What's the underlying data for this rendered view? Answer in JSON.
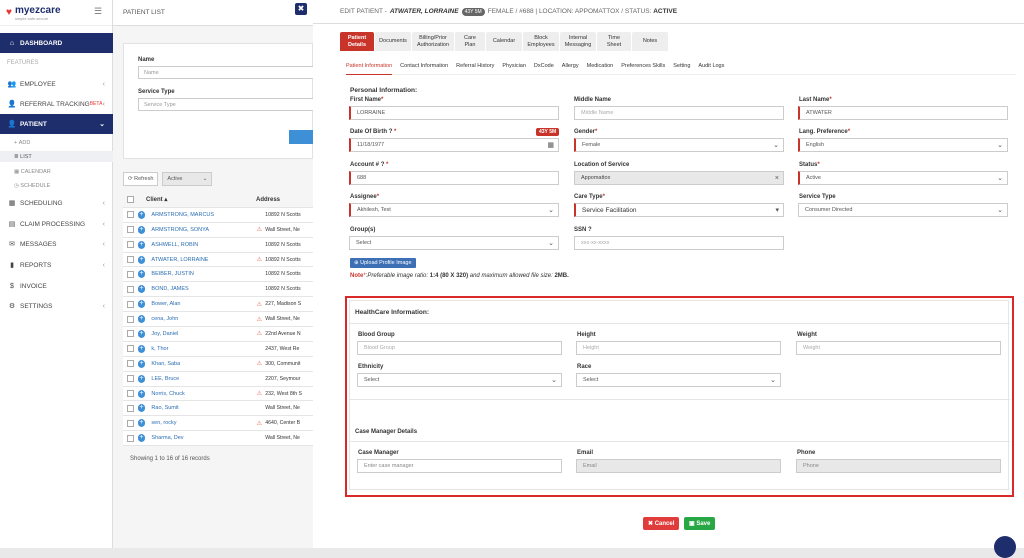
{
  "app": {
    "logo": "myezcare",
    "tagline": "simple.safe.secure"
  },
  "sidebar": {
    "dashboard": "DASHBOARD",
    "features": "FEATURES",
    "employee": "EMPLOYEE",
    "referral": "REFERRAL TRACKING",
    "beta": "beta",
    "patient": "PATIENT",
    "sub": [
      "ADD",
      "LIST",
      "CALENDAR",
      "SCHEDULE"
    ],
    "scheduling": "SCHEDULING",
    "claim": "CLAIM PROCESSING",
    "messages": "MESSAGES",
    "reports": "REPORTS",
    "invoice": "INVOICE",
    "settings": "SETTINGS"
  },
  "plist": {
    "title": "PATIENT LIST",
    "name_label": "Name",
    "name_ph": "Name",
    "stype_label": "Service Type",
    "stype_ph": "Service Type",
    "refresh": "Refresh",
    "active": "Active",
    "col_client": "Client",
    "col_address": "Address",
    "showing": "Showing 1 to 16 of 16 records",
    "rows": [
      {
        "name": "ARMSTRONG, MARCUS",
        "addr": "10892 N Scotts",
        "warn": ""
      },
      {
        "name": "ARMSTRONG, SONYA",
        "addr": "Wall Street, Ne",
        "warn": "⚠"
      },
      {
        "name": "ASHWELL, ROBIN",
        "addr": "10892 N Scotts",
        "warn": ""
      },
      {
        "name": "ATWATER, LORRAINE",
        "addr": "10892 N Scotts",
        "warn": "⚠"
      },
      {
        "name": "BEIBER, JUSTIN",
        "addr": "10892 N Scotts",
        "warn": ""
      },
      {
        "name": "BOND, JAMES",
        "addr": "10892 N Scotts",
        "warn": ""
      },
      {
        "name": "Bower, Alan",
        "addr": "227, Madison S",
        "warn": "⚠"
      },
      {
        "name": "cena, John",
        "addr": "Wall Street, Ne",
        "warn": "⚠"
      },
      {
        "name": "Joy, Daniel",
        "addr": "22nd Avenue N",
        "warn": "⚠"
      },
      {
        "name": "k, Thor",
        "addr": "2437, West Re",
        "warn": ""
      },
      {
        "name": "Khan, Saba",
        "addr": "300, Communit",
        "warn": "⚠"
      },
      {
        "name": "LEE, Bruce",
        "addr": "2207, Seymour",
        "warn": ""
      },
      {
        "name": "Norris, Chuck",
        "addr": "232, West 8th S",
        "warn": "⚠"
      },
      {
        "name": "Rao, Sumit",
        "addr": "Wall Street, Ne",
        "warn": ""
      },
      {
        "name": "sen, rocky",
        "addr": "4640, Center B",
        "warn": "⚠"
      },
      {
        "name": "Sharma, Dev",
        "addr": "Wall Street, Ne",
        "warn": ""
      }
    ]
  },
  "modal": {
    "head_prefix": "EDIT PATIENT -",
    "name": "ATWATER, LORRAINE",
    "age": "43Y 5M",
    "gender_id": "FEMALE / #688",
    "location": "LOCATION: APPOMATTOX",
    "status_prefix": "STATUS:",
    "status": "ACTIVE",
    "tabs": [
      "Patient Details",
      "Documents",
      "Billing/Prior Authorization",
      "Care Plan",
      "Calendar",
      "Block Employees",
      "Internal Messaging",
      "Time Sheet",
      "Notes"
    ],
    "subtabs": [
      "Patient Information",
      "Contact Information",
      "Referral History",
      "Physician",
      "DxCode",
      "Allergy",
      "Medication",
      "Preferences Skills",
      "Setting",
      "Audit Logs"
    ],
    "personal": "Personal Information:",
    "first_name_l": "First Name",
    "first_name": "LORRAINE",
    "middle_name_l": "Middle Name",
    "middle_name_ph": "Middle Name",
    "last_name_l": "Last Name",
    "last_name": "ATWATER",
    "dob_l": "Date Of Birth",
    "dob": "11/18/1977",
    "age_badge": "43Y 5M",
    "gender_l": "Gender",
    "gender": "Female",
    "lang_l": "Lang. Preference",
    "lang": "English",
    "account_l": "Account #",
    "account": "688",
    "los_l": "Location of Service",
    "los": "Appomattox",
    "status_l": "Status",
    "status_v": "Active",
    "assignee_l": "Assignee",
    "assignee": "Akhilesh, Test",
    "care_l": "Care Type",
    "care": "Service Facilitation",
    "stype_l": "Service Type",
    "stype": "Consumer Directed",
    "groups_l": "Group(s)",
    "groups": "Select",
    "ssn_l": "SSN",
    "ssn_ph": "xxx-xx-xxxx",
    "upload": "Upload Profile Image",
    "note_b": "Note",
    "note_t": "Preferable image ratio:",
    "note_r": "1:4 (80 X 320)",
    "note_m": " and maximum allowed file size:",
    "note_s": "2MB.",
    "health": "HealthCare Information:",
    "blood_l": "Blood Group",
    "blood_ph": "Blood Group",
    "height_l": "Height",
    "height_ph": "Height",
    "weight_l": "Weight",
    "weight_ph": "Weight",
    "eth_l": "Ethnicity",
    "eth": "Select",
    "race_l": "Race",
    "race": "Select",
    "cm": "Case Manager Details",
    "cm_l": "Case Manager",
    "cm_ph": "Enter case manager",
    "email_l": "Email",
    "email_ph": "Email",
    "phone_l": "Phone",
    "phone_ph": "Phone",
    "cancel": "Cancel",
    "save": "Save"
  }
}
